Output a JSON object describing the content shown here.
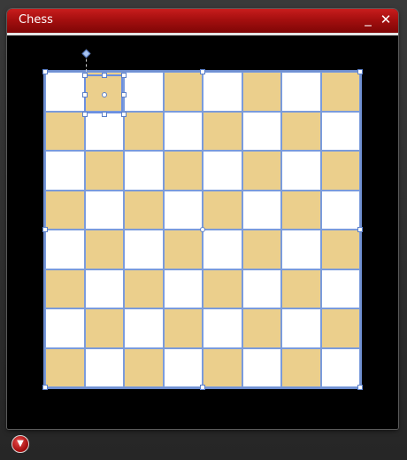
{
  "window": {
    "title": "Chess",
    "minimize_glyph": "_",
    "close_glyph": "✕"
  },
  "board": {
    "rows": 8,
    "cols": 8,
    "light_color": "#ffffff",
    "dark_color": "#ebcf8c",
    "grid_color": "#7a9bdc",
    "selected_cell": {
      "row": 0,
      "col": 1
    }
  },
  "footer": {
    "expand_glyph": "▼",
    "accent_color": "#b01010"
  }
}
